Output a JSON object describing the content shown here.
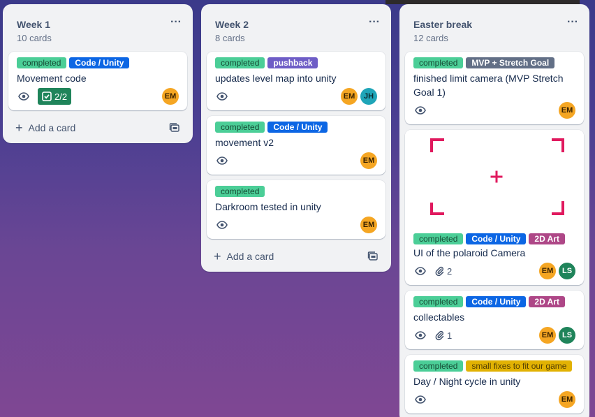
{
  "lists": [
    {
      "title": "Week 1",
      "count": "10 cards",
      "add_label": "Add a card",
      "cards": [
        {
          "labels": [
            "completed",
            "Code / Unity"
          ],
          "title": "Movement code",
          "checklist": "2/2",
          "members": [
            "EM"
          ]
        }
      ]
    },
    {
      "title": "Week 2",
      "count": "8 cards",
      "add_label": "Add a card",
      "cards": [
        {
          "labels": [
            "completed",
            "pushback"
          ],
          "title": "updates level map into unity",
          "members": [
            "EM",
            "JH"
          ]
        },
        {
          "labels": [
            "completed",
            "Code / Unity"
          ],
          "title": "movement v2",
          "members": [
            "EM"
          ]
        },
        {
          "labels": [
            "completed"
          ],
          "title": "Darkroom tested in unity",
          "members": [
            "EM"
          ]
        }
      ]
    },
    {
      "title": "Easter break",
      "count": "12 cards",
      "cards": [
        {
          "labels": [
            "completed",
            "MVP + Stretch Goal"
          ],
          "title": "finished limit camera (MVP Stretch Goal 1)",
          "members": [
            "EM"
          ]
        },
        {
          "labels": [
            "completed",
            "Code / Unity",
            "2D Art"
          ],
          "title": "UI of the polaroid Camera",
          "attachments": "2",
          "members": [
            "EM",
            "LS"
          ],
          "cover": "viewfinder-frame"
        },
        {
          "labels": [
            "completed",
            "Code / Unity",
            "2D Art"
          ],
          "title": "collectables",
          "attachments": "1",
          "members": [
            "EM",
            "LS"
          ]
        },
        {
          "labels": [
            "completed",
            "small fixes to fit our game"
          ],
          "title": "Day / Night cycle in unity",
          "members": [
            "EM"
          ]
        }
      ]
    }
  ],
  "menu_glyph": "···",
  "add_glyph": "+",
  "colors": {
    "completed": "#4bce97",
    "code_unity": "#0c66e4",
    "pushback": "#6e5dc6",
    "mvp": "#626f86",
    "art_2d": "#ae4787",
    "small_fixes": "#e2b203",
    "checklist_done": "#1f845a"
  }
}
